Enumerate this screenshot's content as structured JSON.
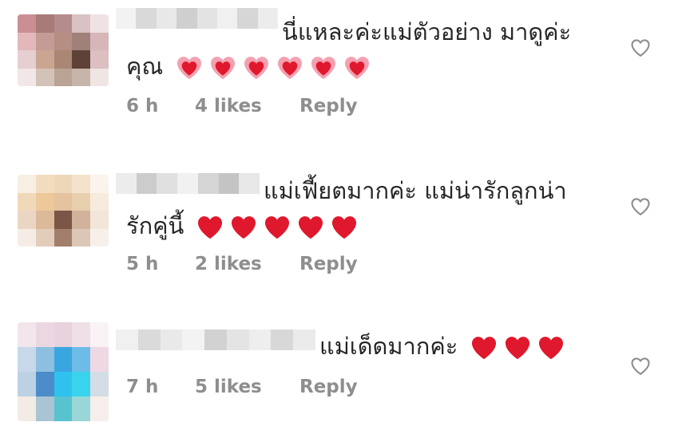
{
  "comments": [
    {
      "text_line1": "นี่แหละค่ะแม่ตัวอย่าง มาดูค่ะ",
      "text_line2": "คุณ",
      "time": "6 h",
      "likes": "4 likes",
      "reply": "Reply",
      "emoji": "growing-heart-icon",
      "emoji_count": 6
    },
    {
      "text_line1": "แม่เฟี้ยตมากค่ะ  แม่น่ารักลูกน่า",
      "text_line2": "รักคู่นี้",
      "time": "5 h",
      "likes": "2 likes",
      "reply": "Reply",
      "emoji": "red-heart-icon",
      "emoji_count": 5
    },
    {
      "text_line1": "แม่เด็ดมากค่ะ",
      "time": "7 h",
      "likes": "5 likes",
      "reply": "Reply",
      "emoji": "red-heart-icon",
      "emoji_count": 3
    }
  ],
  "colors": {
    "text": "#262626",
    "meta": "#8e8e8e",
    "heart_red": "#e0182d",
    "heart_pink": "#f3a1b1",
    "like_outline": "#8e8e8e"
  }
}
